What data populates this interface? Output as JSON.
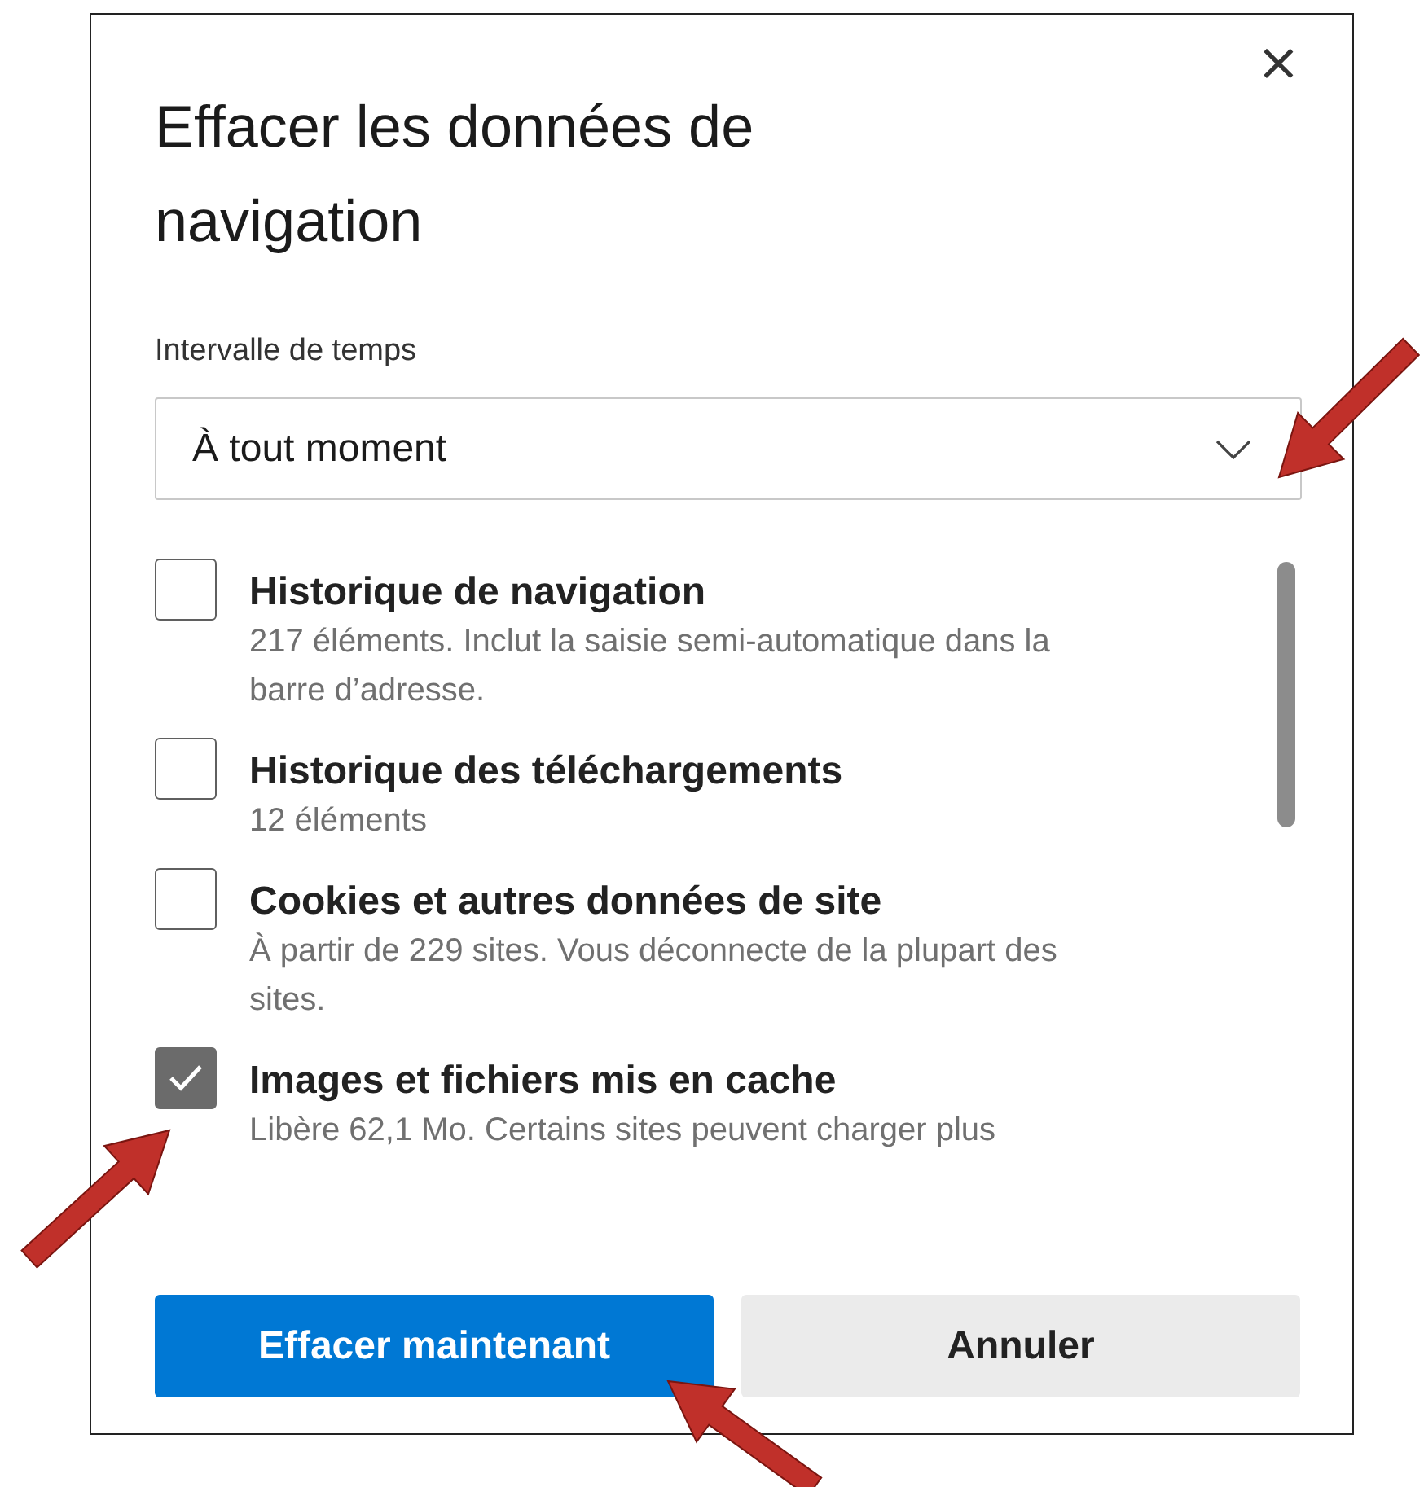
{
  "dialog": {
    "title": "Effacer les données de navigation",
    "close": "×"
  },
  "time_range": {
    "label": "Intervalle de temps",
    "value": "À tout moment"
  },
  "options": [
    {
      "title": "Historique de navigation",
      "description": "217 éléments. Inclut la saisie semi-automatique dans la barre d’adresse.",
      "checked": false
    },
    {
      "title": "Historique des téléchargements",
      "description": "12 éléments",
      "checked": false
    },
    {
      "title": "Cookies et autres données de site",
      "description": "À partir de 229 sites. Vous déconnecte de la plupart des sites.",
      "checked": false
    },
    {
      "title": "Images et fichiers mis en cache",
      "description": "Libère 62,1 Mo. Certains sites peuvent charger plus",
      "checked": true
    }
  ],
  "buttons": [
    {
      "label": "Effacer maintenant",
      "kind": "primary"
    },
    {
      "label": "Annuler",
      "kind": "secondary"
    }
  ]
}
